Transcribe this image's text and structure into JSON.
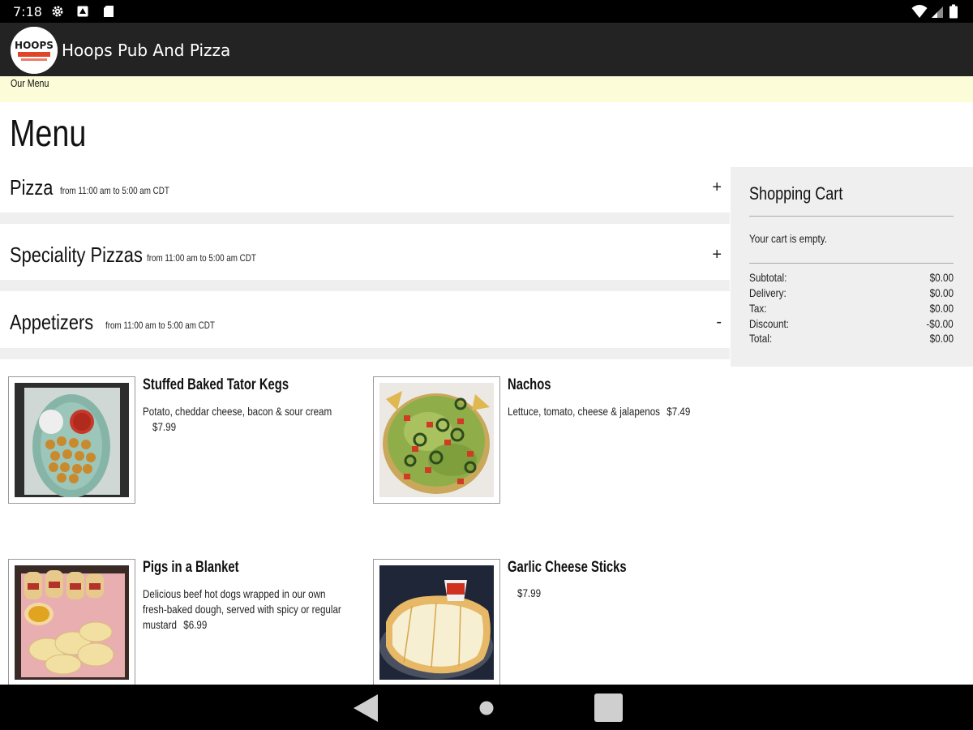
{
  "status_bar": {
    "time": "7:18",
    "icons": [
      "settings-icon",
      "notification-icon",
      "sd-card-icon",
      "wifi-icon",
      "signal-icon",
      "battery-icon"
    ]
  },
  "app_bar": {
    "title": "Hoops Pub And Pizza",
    "logo_text": "HOOPS"
  },
  "breadcrumb": "Our Menu",
  "page_title": "Menu",
  "categories": [
    {
      "name": "Pizza",
      "hours": "from 11:00 am to 5:00 am CDT",
      "toggle": "+"
    },
    {
      "name": "Speciality Pizzas",
      "hours": "from 11:00 am to 5:00 am CDT",
      "toggle": "+"
    },
    {
      "name": "Appetizers",
      "hours": "from 11:00 am to 5:00 am CDT",
      "toggle": "-"
    }
  ],
  "items": [
    {
      "name": "Stuffed Baked Tator Kegs",
      "description": "Potato, cheddar cheese, bacon & sour cream",
      "price": "$7.99",
      "image": "tator-kegs-photo"
    },
    {
      "name": "Nachos",
      "description": "Lettuce, tomato, cheese & jalapenos",
      "price": "$7.49",
      "image": "nachos-photo"
    },
    {
      "name": "Pigs in a Blanket",
      "description": "Delicious beef hot dogs wrapped in our own fresh-baked dough, served with spicy or regular mustard",
      "price": "$6.99",
      "image": "pigs-in-blanket-photo"
    },
    {
      "name": "Garlic Cheese Sticks",
      "description": "",
      "price": "$7.99",
      "image": "cheese-sticks-photo"
    }
  ],
  "cart": {
    "title": "Shopping Cart",
    "empty_text": "Your cart is empty.",
    "rows": [
      {
        "label": "Subtotal:",
        "value": "$0.00"
      },
      {
        "label": "Delivery:",
        "value": "$0.00"
      },
      {
        "label": "Tax:",
        "value": "$0.00"
      },
      {
        "label": "Discount:",
        "value": "-$0.00"
      },
      {
        "label": "Total:",
        "value": "$0.00"
      }
    ]
  },
  "nav_bar": {
    "icons": [
      "back-icon",
      "home-icon",
      "recents-icon"
    ]
  },
  "colors": {
    "status_bar": "#000000",
    "app_bar": "#232323",
    "breadcrumb_band": "#fcfcd9",
    "divider": "#efefef",
    "cart_bg": "#efefef"
  }
}
